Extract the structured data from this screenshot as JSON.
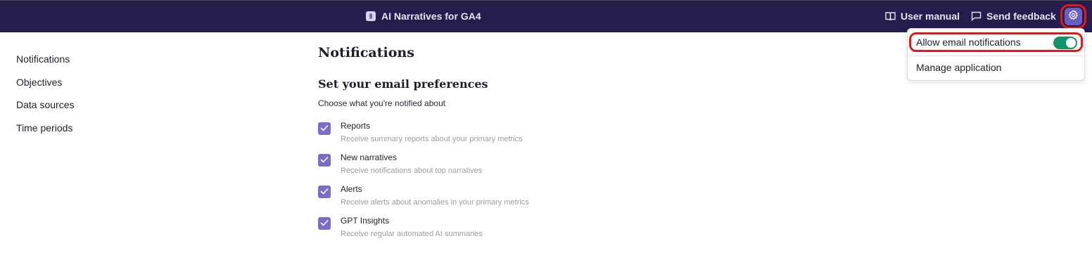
{
  "header": {
    "app_title": "AI Narratives for GA4",
    "user_manual": "User manual",
    "send_feedback": "Send feedback",
    "icons": [
      "book-icon",
      "chat-bubble-icon",
      "gear-icon"
    ]
  },
  "sidebar": {
    "items": [
      {
        "label": "Notifications"
      },
      {
        "label": "Objectives"
      },
      {
        "label": "Data sources"
      },
      {
        "label": "Time periods"
      }
    ]
  },
  "main": {
    "title": "Notifications",
    "section_title": "Set your email preferences",
    "section_desc": "Choose what you're notified about",
    "options": [
      {
        "label": "Reports",
        "desc": "Receive summary reports about your primary metrics",
        "checked": true
      },
      {
        "label": "New narratives",
        "desc": "Receive notifications about top narratives",
        "checked": true
      },
      {
        "label": "Alerts",
        "desc": "Receive alerts about anomalies in your primary metrics",
        "checked": true
      },
      {
        "label": "GPT Insights",
        "desc": "Receive regular automated AI summaries",
        "checked": true
      }
    ]
  },
  "settings_menu": {
    "allow_email": "Allow email notifications",
    "allow_email_enabled": true,
    "manage_app": "Manage application"
  },
  "colors": {
    "topbar": "#271d4d",
    "accent": "#6a5fc1",
    "checkbox": "#7a6cc8",
    "toggle_on": "#15916b",
    "highlight": "#e01a1a"
  }
}
